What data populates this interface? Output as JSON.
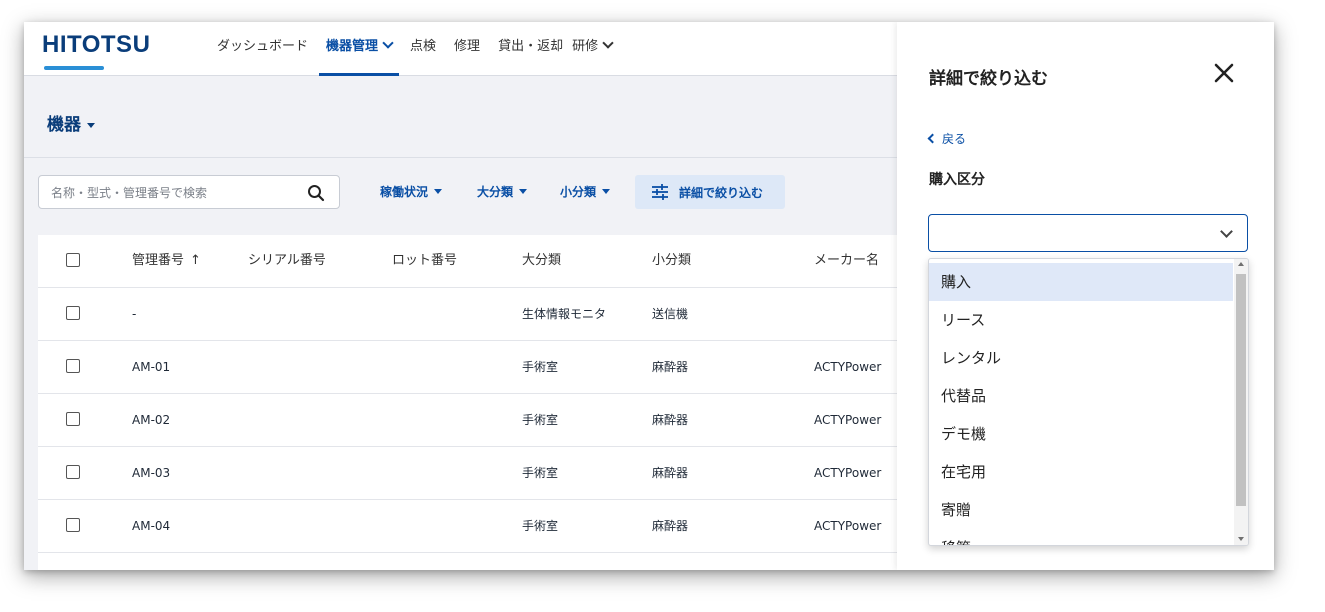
{
  "brand": {
    "logo_text": "HITOTSU",
    "accent": "#0a4fa5",
    "logo_bar": "#2a8fd6"
  },
  "nav": {
    "items": [
      {
        "label": "ダッシュボード",
        "dropdown": false,
        "active": false
      },
      {
        "label": "機器管理",
        "dropdown": true,
        "active": true
      },
      {
        "label": "点検",
        "dropdown": false,
        "active": false
      },
      {
        "label": "修理",
        "dropdown": false,
        "active": false
      },
      {
        "label": "貸出・返却",
        "dropdown": false,
        "active": false
      },
      {
        "label": "研修",
        "dropdown": true,
        "active": false
      }
    ]
  },
  "page": {
    "title": "機器"
  },
  "search": {
    "placeholder": "名称・型式・管理番号で検索",
    "value": ""
  },
  "filters": {
    "status": "稼働状況",
    "major": "大分類",
    "minor": "小分類",
    "detail": "詳細で絞り込む"
  },
  "table": {
    "columns": [
      "管理番号",
      "シリアル番号",
      "ロット番号",
      "大分類",
      "小分類",
      "メーカー名"
    ],
    "sort_indicator": "↑",
    "rows": [
      [
        "-",
        "",
        "",
        "生体情報モニタ",
        "送信機",
        ""
      ],
      [
        "AM-01",
        "",
        "",
        "手術室",
        "麻酔器",
        "ACTYPower"
      ],
      [
        "AM-02",
        "",
        "",
        "手術室",
        "麻酔器",
        "ACTYPower"
      ],
      [
        "AM-03",
        "",
        "",
        "手術室",
        "麻酔器",
        "ACTYPower"
      ],
      [
        "AM-04",
        "",
        "",
        "手術室",
        "麻酔器",
        "ACTYPower"
      ]
    ]
  },
  "panel": {
    "title": "詳細で絞り込む",
    "back": "戻る",
    "section": "購入区分",
    "select_value": "",
    "options": [
      "購入",
      "リース",
      "レンタル",
      "代替品",
      "デモ機",
      "在宅用",
      "寄贈",
      "移管"
    ],
    "highlighted_option": "購入"
  }
}
